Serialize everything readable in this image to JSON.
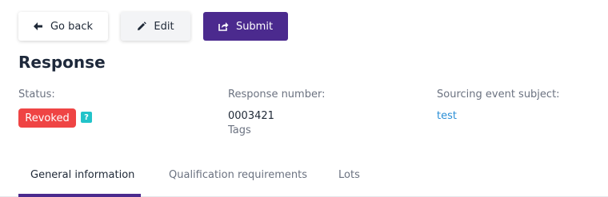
{
  "toolbar": {
    "back_label": "Go back",
    "edit_label": "Edit",
    "submit_label": "Submit"
  },
  "page_title": "Response",
  "fields": {
    "status": {
      "label": "Status:",
      "value": "Revoked",
      "help": "?"
    },
    "response_number": {
      "label": "Response number:",
      "value": "0003421",
      "tags_label": "Tags"
    },
    "sourcing_event_subject": {
      "label": "Sourcing event subject:",
      "value": "test"
    }
  },
  "tabs": [
    {
      "label": "General information",
      "active": true
    },
    {
      "label": "Qualification requirements",
      "active": false
    },
    {
      "label": "Lots",
      "active": false
    }
  ],
  "colors": {
    "primary": "#4b2a8e",
    "revoked": "#ef4444",
    "help": "#22c3c9",
    "link": "#2b8fd6"
  },
  "icons": {
    "back": "arrow-left-icon",
    "edit": "pencil-icon",
    "submit": "share-icon"
  }
}
